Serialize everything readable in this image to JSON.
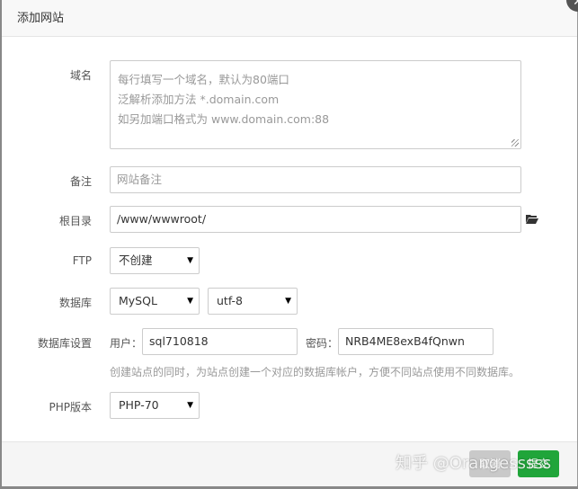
{
  "title": "添加网站",
  "close_icon": "close-icon",
  "fields": {
    "domain": {
      "label": "域名",
      "placeholder_lines": [
        "每行填写一个域名，默认为80端口",
        "泛解析添加方法 *.domain.com",
        "如另加端口格式为 www.domain.com:88"
      ]
    },
    "remark": {
      "label": "备注",
      "placeholder": "网站备注"
    },
    "root": {
      "label": "根目录",
      "value": "/www/wwwroot/",
      "icon": "folder-open-icon"
    },
    "ftp": {
      "label": "FTP",
      "value": "不创建"
    },
    "database": {
      "label": "数据库",
      "type": "MySQL",
      "charset": "utf-8"
    },
    "db_settings": {
      "label": "数据库设置",
      "user_label": "用户：",
      "user": "sql710818",
      "pass_label": "密码：",
      "pass": "NRB4ME8exB4fQnwn",
      "hint": "创建站点的同时，为站点创建一个对应的数据库帐户，方便不同站点使用不同数据库。"
    },
    "php": {
      "label": "PHP版本",
      "value": "PHP-70"
    }
  },
  "footer": {
    "cancel": "取消",
    "submit": "提交",
    "cancel_color": "#c9c9c9",
    "submit_color": "#20a53a"
  },
  "watermark": "知乎 @Orangesssss"
}
